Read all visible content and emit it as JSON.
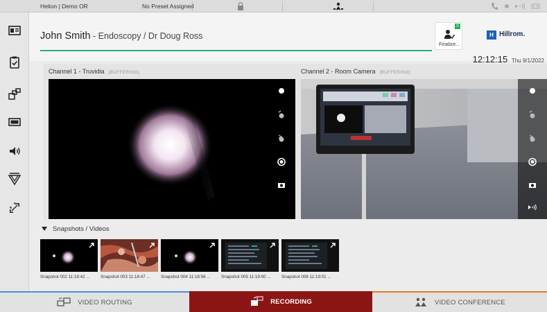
{
  "topbar": {
    "system_name": "Helion | Demo OR",
    "preset": "No Preset Assigned"
  },
  "header": {
    "patient_name": "John Smith",
    "procedure": " - Endoscopy / Dr Doug Ross",
    "finalize_label": "Finalize...",
    "finalize_badge": "0",
    "logo_mark": "H",
    "logo_text": "Hillrom.",
    "time": "12:12:15",
    "date": "Thu 9/1/2022",
    "accent_color": "#2aa88a"
  },
  "sidebar": {
    "items": [
      {
        "icon": "patient-card-icon"
      },
      {
        "icon": "clipboard-check-icon"
      },
      {
        "icon": "layout-icon"
      },
      {
        "icon": "display-icon"
      },
      {
        "icon": "speaker-icon"
      },
      {
        "icon": "surgical-light-icon"
      },
      {
        "icon": "expand-icon"
      }
    ]
  },
  "channels": [
    {
      "title": "Channel 1 - Truvidia",
      "status": "[BUFFERING]"
    },
    {
      "title": "Channel 2 - Room Camera",
      "status": "[BUFFERING]"
    }
  ],
  "snapshots": {
    "header": "Snapshots / Videos",
    "items": [
      {
        "caption": "Snapshot 002 11:18:42 ...",
        "kind": "endoscope"
      },
      {
        "caption": "Snapshot 003 11:18:47 ...",
        "kind": "surgery"
      },
      {
        "caption": "Snapshot 004 11:18:56 ...",
        "kind": "endoscope"
      },
      {
        "caption": "Snapshot 005 11:19:00 ...",
        "kind": "monitor"
      },
      {
        "caption": "Snapshot 006 11:19:01 ...",
        "kind": "monitor"
      }
    ]
  },
  "tabs": [
    {
      "label": "VIDEO ROUTING",
      "active": false
    },
    {
      "label": "RECORDING",
      "active": true
    },
    {
      "label": "VIDEO CONFERENCE",
      "active": false
    }
  ],
  "colors": {
    "recording_tab": "#8b1515",
    "video_routing_line": "#4a8fd8",
    "video_conference_line": "#e07b2a"
  }
}
